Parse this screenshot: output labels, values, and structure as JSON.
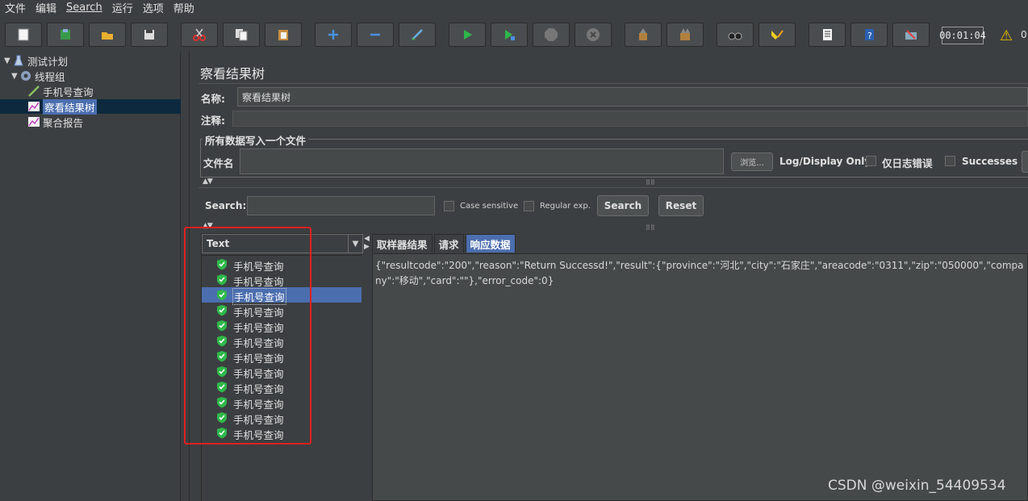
{
  "menu": [
    "文件",
    "编辑",
    "Search",
    "运行",
    "选项",
    "帮助"
  ],
  "toolbar": {
    "buttons": [
      "new-icon",
      "templates-icon",
      "open-icon",
      "save-icon",
      "cut-icon",
      "copy-icon",
      "paste-icon",
      "expand-icon",
      "collapse-icon",
      "toggle-icon",
      "start-icon",
      "start-no-pause-icon",
      "stop-icon",
      "shutdown-icon",
      "clear-icon",
      "clear-all-icon",
      "search-icon",
      "reset-search-icon",
      "function-helper-icon",
      "help-icon",
      "remote-icon"
    ],
    "timer": "00:01:04",
    "warning_count": "0"
  },
  "tree": {
    "items": [
      {
        "label": "测试计划",
        "icon": "test-plan-icon"
      },
      {
        "label": "线程组",
        "icon": "thread-group-icon"
      },
      {
        "label": "手机号查询",
        "icon": "http-sampler-icon"
      },
      {
        "label": "察看结果树",
        "icon": "listener-icon"
      },
      {
        "label": "聚合报告",
        "icon": "listener-icon"
      }
    ]
  },
  "panel": {
    "title": "察看结果树",
    "name_label": "名称:",
    "name_value": "察看结果树",
    "comment_label": "注释:",
    "file_section_label": "所有数据写入一个文件",
    "file_label": "文件名",
    "browse_label": "浏览...",
    "log_only_label": "Log/Display Only:",
    "errors_label": "仅日志错误",
    "successes_label": "Successes"
  },
  "search": {
    "label": "Search:",
    "case_label": "Case sensitive",
    "regex_label": "Regular exp.",
    "search_button": "Search",
    "reset_button": "Reset"
  },
  "results": {
    "renderer": "Text",
    "samples": [
      "手机号查询",
      "手机号查询",
      "手机号查询",
      "手机号查询",
      "手机号查询",
      "手机号查询",
      "手机号查询",
      "手机号查询",
      "手机号查询",
      "手机号查询",
      "手机号查询",
      "手机号查询"
    ],
    "selected_index": 2,
    "tabs": [
      "取样器结果",
      "请求",
      "响应数据"
    ],
    "active_tab": 2,
    "response_text": "{\"resultcode\":\"200\",\"reason\":\"Return Successd!\",\"result\":{\"province\":\"河北\",\"city\":\"石家庄\",\"areacode\":\"0311\",\"zip\":\"050000\",\"company\":\"移动\",\"card\":\"\"},\"error_code\":0}"
  },
  "watermark": "CSDN @weixin_54409534",
  "colors": {
    "background": "#3c3f41",
    "selection": "#4b6eaf",
    "highlight_box": "#e02020",
    "success_check": "#2fb84a"
  }
}
